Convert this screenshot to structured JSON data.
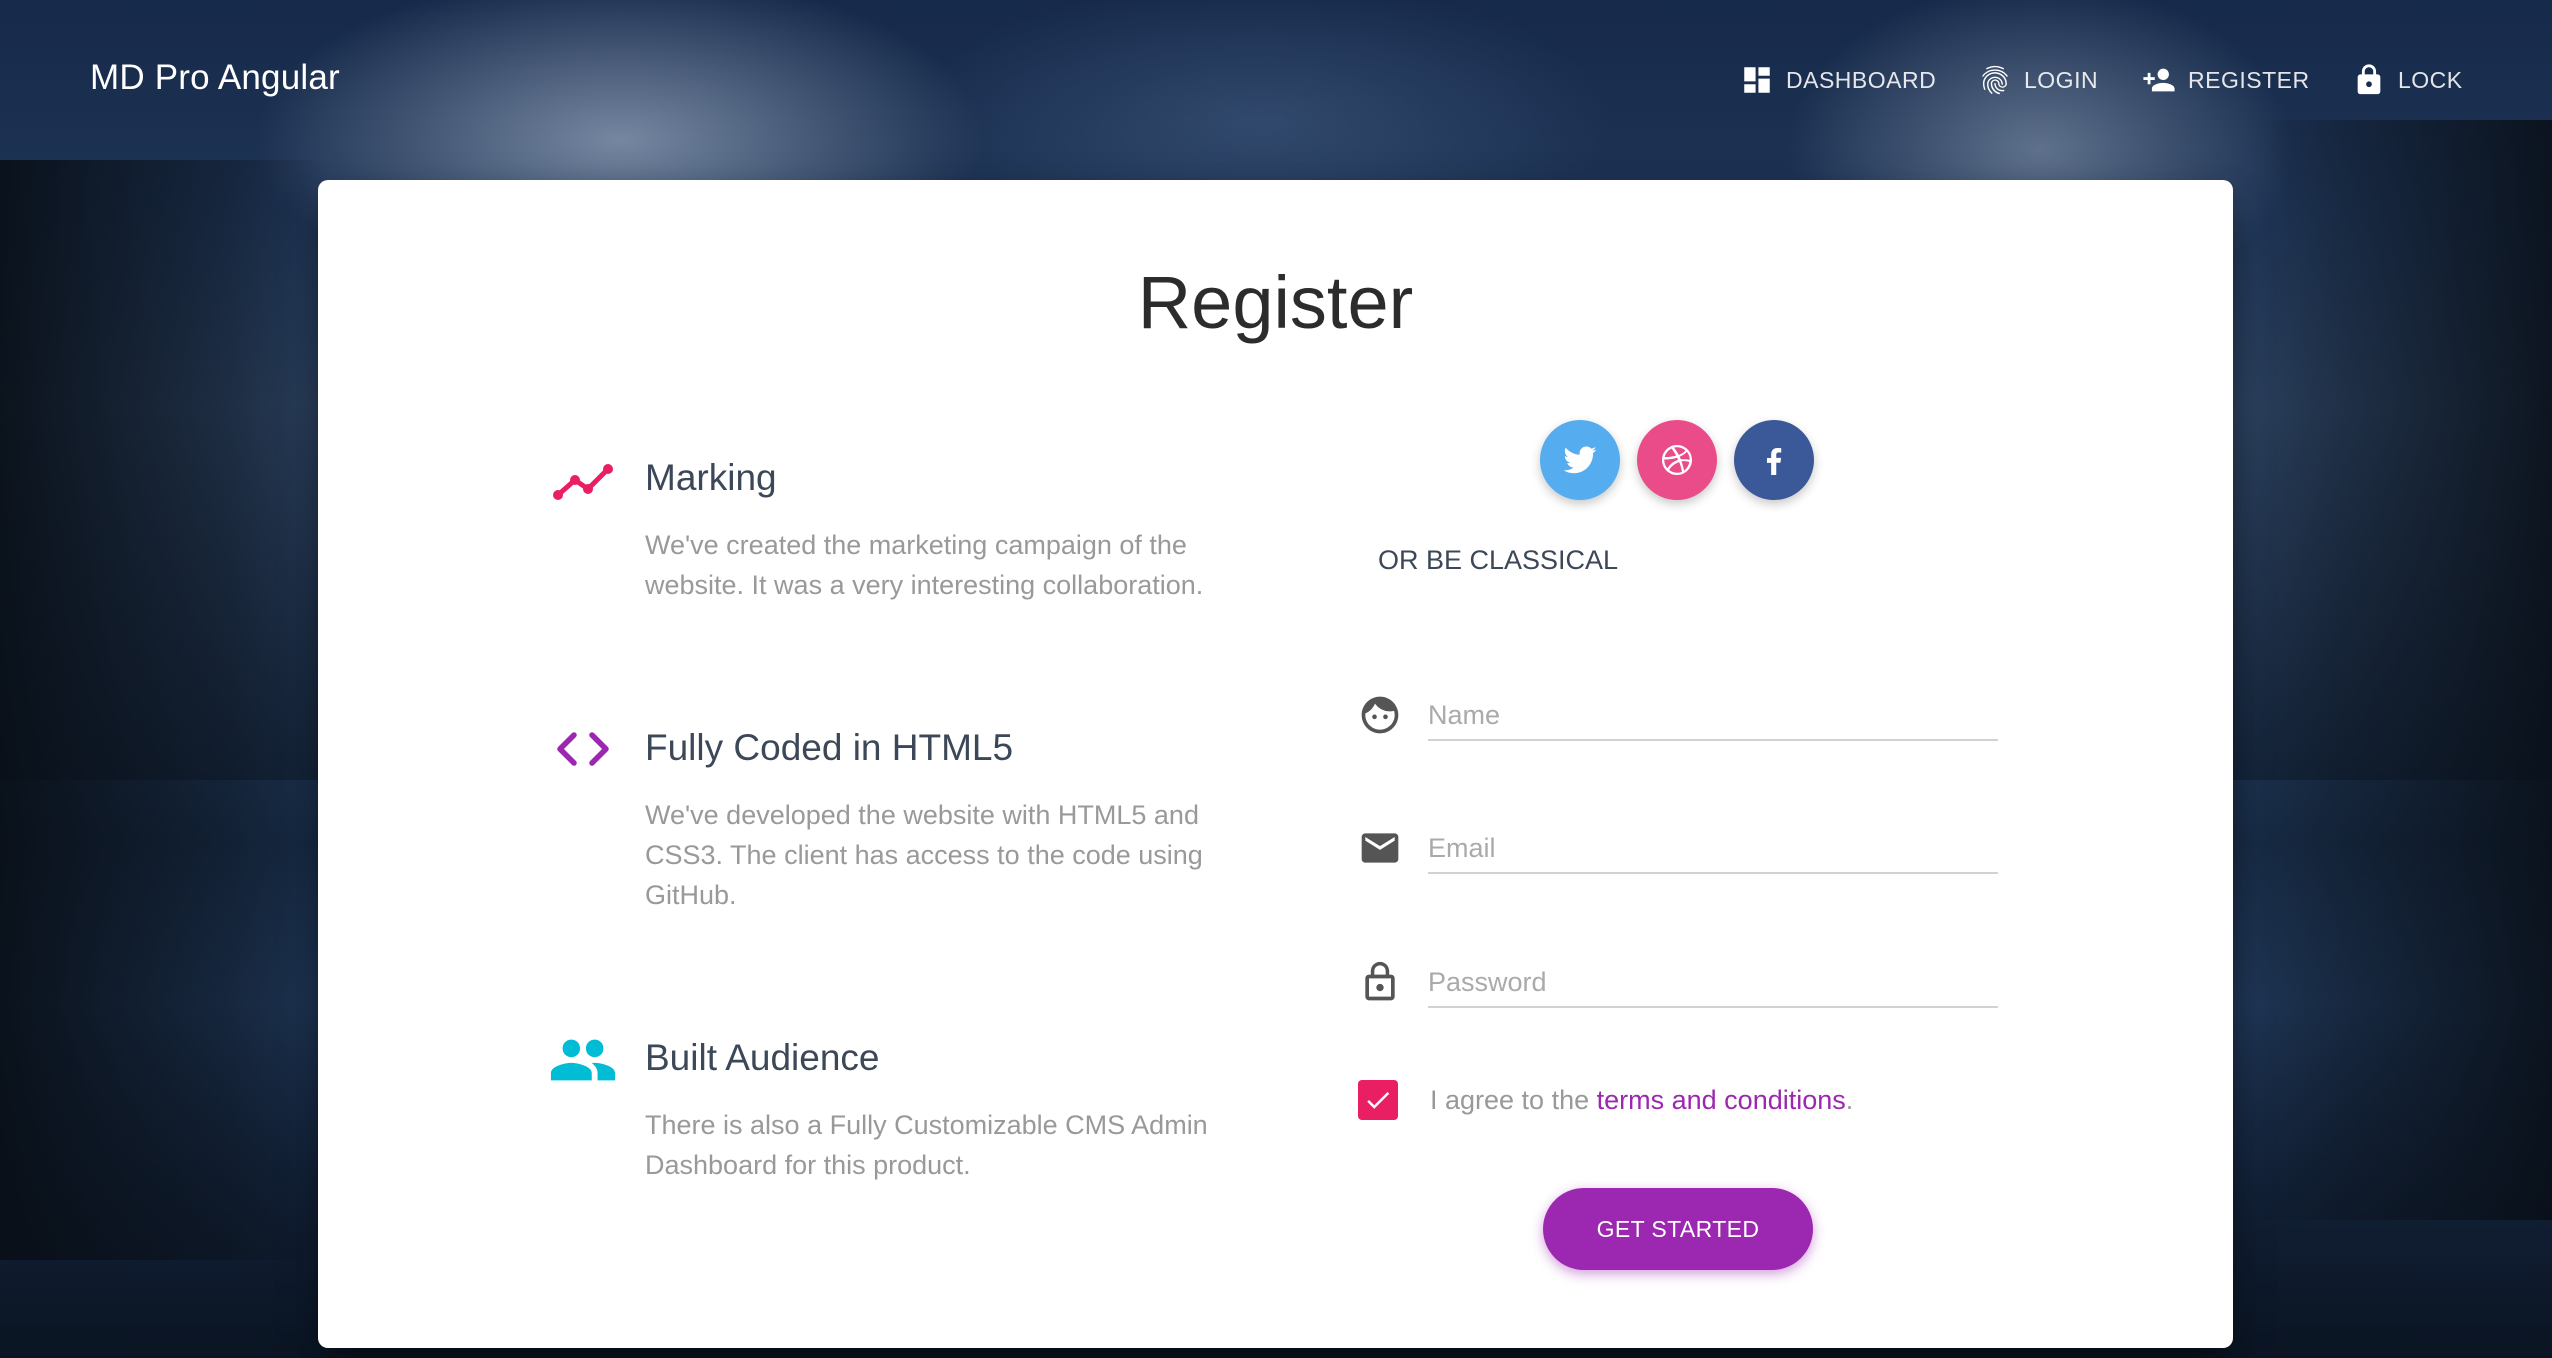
{
  "navbar": {
    "brand": "MD Pro Angular",
    "items": [
      {
        "label": "DASHBOARD",
        "icon": "dashboard-icon"
      },
      {
        "label": "LOGIN",
        "icon": "fingerprint-icon"
      },
      {
        "label": "REGISTER",
        "icon": "person-add-icon"
      },
      {
        "label": "LOCK",
        "icon": "lock-icon"
      }
    ]
  },
  "card": {
    "title": "Register",
    "info": [
      {
        "title": "Marking",
        "description": "We've created the marketing campaign of the website. It was a very interesting collaboration.",
        "icon": "timeline-icon",
        "color": "#e91e63"
      },
      {
        "title": "Fully Coded in HTML5",
        "description": "We've developed the website with HTML5 and CSS3. The client has access to the code using GitHub.",
        "icon": "code-icon",
        "color": "#9c27b0"
      },
      {
        "title": "Built Audience",
        "description": "There is also a Fully Customizable CMS Admin Dashboard for this product.",
        "icon": "group-icon",
        "color": "#00bcd4"
      }
    ],
    "socials": [
      {
        "icon": "twitter-icon",
        "color": "#55acee"
      },
      {
        "icon": "dribbble-icon",
        "color": "#ea4c89"
      },
      {
        "icon": "facebook-icon",
        "color": "#3b5998"
      }
    ],
    "or_text": "OR BE CLASSICAL",
    "fields": {
      "name_placeholder": "Name",
      "email_placeholder": "Email",
      "password_placeholder": "Password"
    },
    "agree": {
      "prefix": "I agree to the ",
      "link": "terms and conditions",
      "suffix": ".",
      "checked": true
    },
    "cta": "GET STARTED"
  },
  "colors": {
    "primary": "#9c27b0",
    "checkbox": "#e91e63"
  }
}
